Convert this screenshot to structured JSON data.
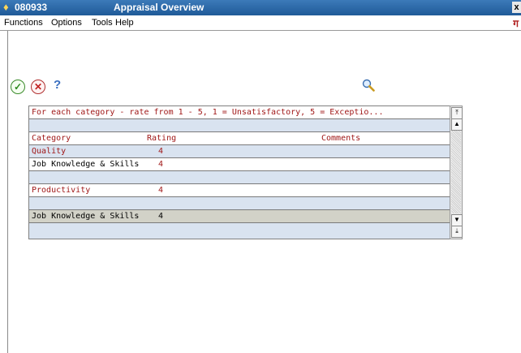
{
  "window": {
    "id": "080933",
    "title": "Appraisal Overview",
    "close_label": "x"
  },
  "menu": {
    "items": [
      {
        "label": "Functions"
      },
      {
        "label": "Options"
      },
      {
        "label": "Tools"
      },
      {
        "label": "Help"
      }
    ]
  },
  "toolbar": {
    "ok_icon": "check-icon",
    "cancel_icon": "cancel-icon",
    "help_label": "?",
    "search_icon": "search-icon"
  },
  "grid": {
    "instructions": "For each category - rate from 1 - 5, 1 = Unsatisfactory, 5 = Exceptio...",
    "headers": {
      "category": "Category",
      "rating": "Rating",
      "comments": "Comments"
    },
    "rows": [
      {
        "category": "Quality",
        "rating": "4"
      },
      {
        "category": "Job Knowledge & Skills",
        "rating": "4"
      },
      {
        "category": "",
        "rating": ""
      },
      {
        "category": "Productivity",
        "rating": "4"
      },
      {
        "category": "",
        "rating": ""
      },
      {
        "category": "Job Knowledge & Skills",
        "rating": "4"
      }
    ]
  }
}
